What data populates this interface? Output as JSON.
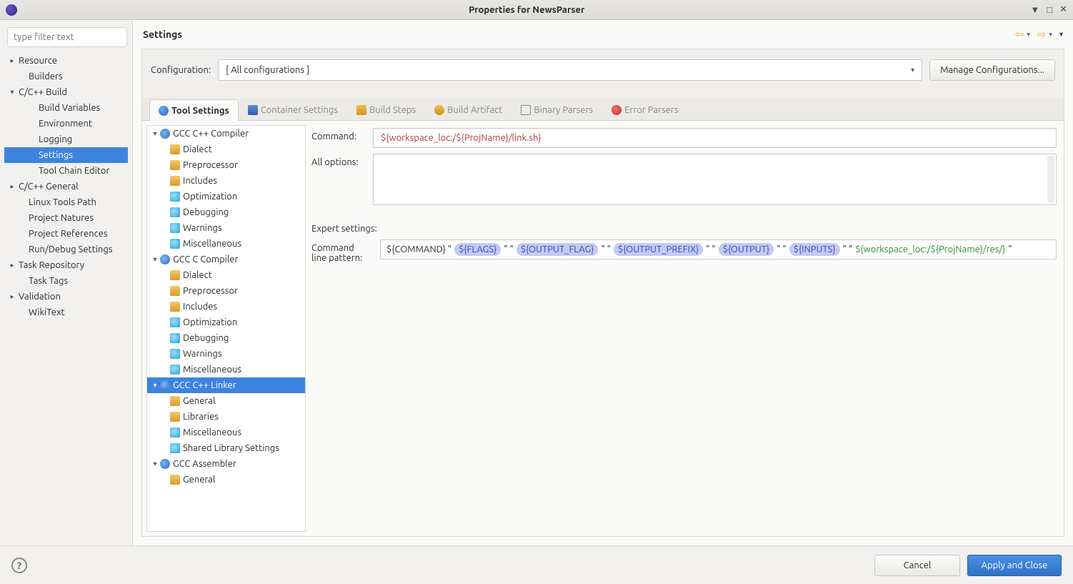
{
  "window": {
    "title": "Properties for NewsParser"
  },
  "header": {
    "title": "Settings"
  },
  "filter": {
    "placeholder": "type filter text"
  },
  "sidebar": [
    {
      "label": "Resource",
      "depth": 0,
      "expandable": true,
      "expanded": false
    },
    {
      "label": "Builders",
      "depth": 1
    },
    {
      "label": "C/C++ Build",
      "depth": 0,
      "expandable": true,
      "expanded": true
    },
    {
      "label": "Build Variables",
      "depth": 2
    },
    {
      "label": "Environment",
      "depth": 2
    },
    {
      "label": "Logging",
      "depth": 2
    },
    {
      "label": "Settings",
      "depth": 2,
      "selected": true
    },
    {
      "label": "Tool Chain Editor",
      "depth": 2
    },
    {
      "label": "C/C++ General",
      "depth": 0,
      "expandable": true,
      "expanded": false
    },
    {
      "label": "Linux Tools Path",
      "depth": 1
    },
    {
      "label": "Project Natures",
      "depth": 1
    },
    {
      "label": "Project References",
      "depth": 1
    },
    {
      "label": "Run/Debug Settings",
      "depth": 1
    },
    {
      "label": "Task Repository",
      "depth": 0,
      "expandable": true,
      "expanded": false
    },
    {
      "label": "Task Tags",
      "depth": 1
    },
    {
      "label": "Validation",
      "depth": 0,
      "expandable": true,
      "expanded": false
    },
    {
      "label": "WikiText",
      "depth": 1
    }
  ],
  "config": {
    "label": "Configuration:",
    "value": "[ All configurations ]",
    "manage_label": "Manage Configurations..."
  },
  "tabs": [
    {
      "label": "Tool Settings",
      "icon": "ico-wrench",
      "active": true
    },
    {
      "label": "Container Settings",
      "icon": "ico-container"
    },
    {
      "label": "Build Steps",
      "icon": "ico-hammer"
    },
    {
      "label": "Build Artifact",
      "icon": "ico-artifact"
    },
    {
      "label": "Binary Parsers",
      "icon": "ico-binary"
    },
    {
      "label": "Error Parsers",
      "icon": "ico-error"
    }
  ],
  "tool_tree": [
    {
      "label": "GCC C++ Compiler",
      "type": "group",
      "expanded": true
    },
    {
      "label": "Dialect",
      "type": "leaf"
    },
    {
      "label": "Preprocessor",
      "type": "leaf"
    },
    {
      "label": "Includes",
      "type": "leaf"
    },
    {
      "label": "Optimization",
      "type": "misc"
    },
    {
      "label": "Debugging",
      "type": "misc"
    },
    {
      "label": "Warnings",
      "type": "misc"
    },
    {
      "label": "Miscellaneous",
      "type": "misc"
    },
    {
      "label": "GCC C Compiler",
      "type": "group",
      "expanded": true
    },
    {
      "label": "Dialect",
      "type": "leaf"
    },
    {
      "label": "Preprocessor",
      "type": "leaf"
    },
    {
      "label": "Includes",
      "type": "leaf"
    },
    {
      "label": "Optimization",
      "type": "misc"
    },
    {
      "label": "Debugging",
      "type": "misc"
    },
    {
      "label": "Warnings",
      "type": "misc"
    },
    {
      "label": "Miscellaneous",
      "type": "misc"
    },
    {
      "label": "GCC C++ Linker",
      "type": "group",
      "expanded": true,
      "selected": true
    },
    {
      "label": "General",
      "type": "leaf"
    },
    {
      "label": "Libraries",
      "type": "leaf"
    },
    {
      "label": "Miscellaneous",
      "type": "misc"
    },
    {
      "label": "Shared Library Settings",
      "type": "misc"
    },
    {
      "label": "GCC Assembler",
      "type": "group",
      "expanded": true
    },
    {
      "label": "General",
      "type": "leaf"
    }
  ],
  "form": {
    "command_label": "Command:",
    "command_value": "${workspace_loc:/${ProjName}/link.sh}",
    "all_options_label": "All options:",
    "expert_label": "Expert settings:",
    "pattern_label1": "Command",
    "pattern_label2": "line pattern:",
    "pattern_parts": {
      "p0": "${COMMAND} \"",
      "p1": "${FLAGS}",
      "p2": "\" \"",
      "p3": "${OUTPUT_FLAG}",
      "p4": "\" \"",
      "p5": "${OUTPUT_PREFIX}",
      "p6": "\" \"",
      "p7": "${OUTPUT}",
      "p8": "\" \"",
      "p9": "${INPUTS}",
      "p10": "\" \"",
      "p11": "${workspace_loc:/${ProjName}/res/}",
      "p12": "\""
    }
  },
  "footer": {
    "cancel": "Cancel",
    "apply": "Apply and Close"
  }
}
